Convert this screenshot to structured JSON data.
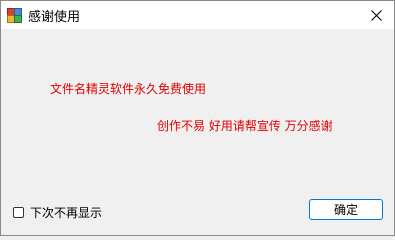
{
  "window": {
    "title": "感谢使用",
    "close_glyph": "✕"
  },
  "body": {
    "line1": "文件名精灵软件永久免费使用",
    "line2": "创作不易 好用请帮宣传 万分感谢"
  },
  "footer": {
    "checkbox_label": "下次不再显示",
    "checkbox_checked": false,
    "ok_label": "确定"
  },
  "colors": {
    "message": "#e00000",
    "accent": "#0078d4"
  },
  "icons": [
    "app-icon",
    "close-icon"
  ]
}
